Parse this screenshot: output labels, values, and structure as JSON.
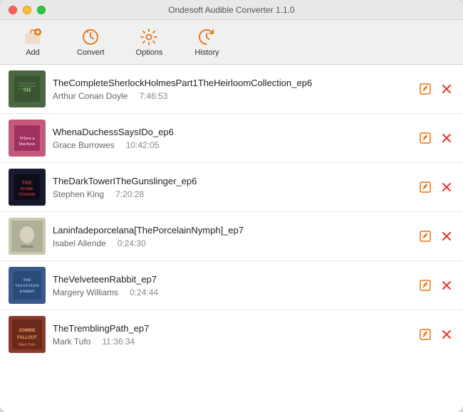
{
  "window": {
    "title": "Ondesoft Audible Converter 1.1.0"
  },
  "toolbar": {
    "add_label": "Add",
    "convert_label": "Convert",
    "options_label": "Options",
    "history_label": "History"
  },
  "books": [
    {
      "id": 1,
      "title": "TheCompleteSherlockHolmesPart1TheHeirloomCollection_ep6",
      "author": "Arthur Conan Doyle",
      "duration": "7:46:53",
      "cover_color": "#4a6741",
      "cover_color2": "#2d4a28"
    },
    {
      "id": 2,
      "title": "WhenaDuchessSaysIDo_ep6",
      "author": "Grace Burrowes",
      "duration": "10:42:05",
      "cover_color": "#c45a7a",
      "cover_color2": "#a03060"
    },
    {
      "id": 3,
      "title": "TheDarkTowerITheGunslinger_ep6",
      "author": "Stephen King",
      "duration": "7:20:28",
      "cover_color": "#1a1a2e",
      "cover_color2": "#16213e"
    },
    {
      "id": 4,
      "title": "Laninfadeporcelana[ThePorcelainNymph]_ep7",
      "author": "Isabel Allende",
      "duration": "0:24:30",
      "cover_color": "#b8b8a0",
      "cover_color2": "#a0a088"
    },
    {
      "id": 5,
      "title": "TheVelveteenRabbit_ep7",
      "author": "Margery Williams",
      "duration": "0:24:44",
      "cover_color": "#3a5a8a",
      "cover_color2": "#2a4a7a"
    },
    {
      "id": 6,
      "title": "TheTremblingPath_ep7",
      "author": "Mark Tufo",
      "duration": "11:36:34",
      "cover_color": "#8a3a2a",
      "cover_color2": "#6a2a1a"
    }
  ]
}
